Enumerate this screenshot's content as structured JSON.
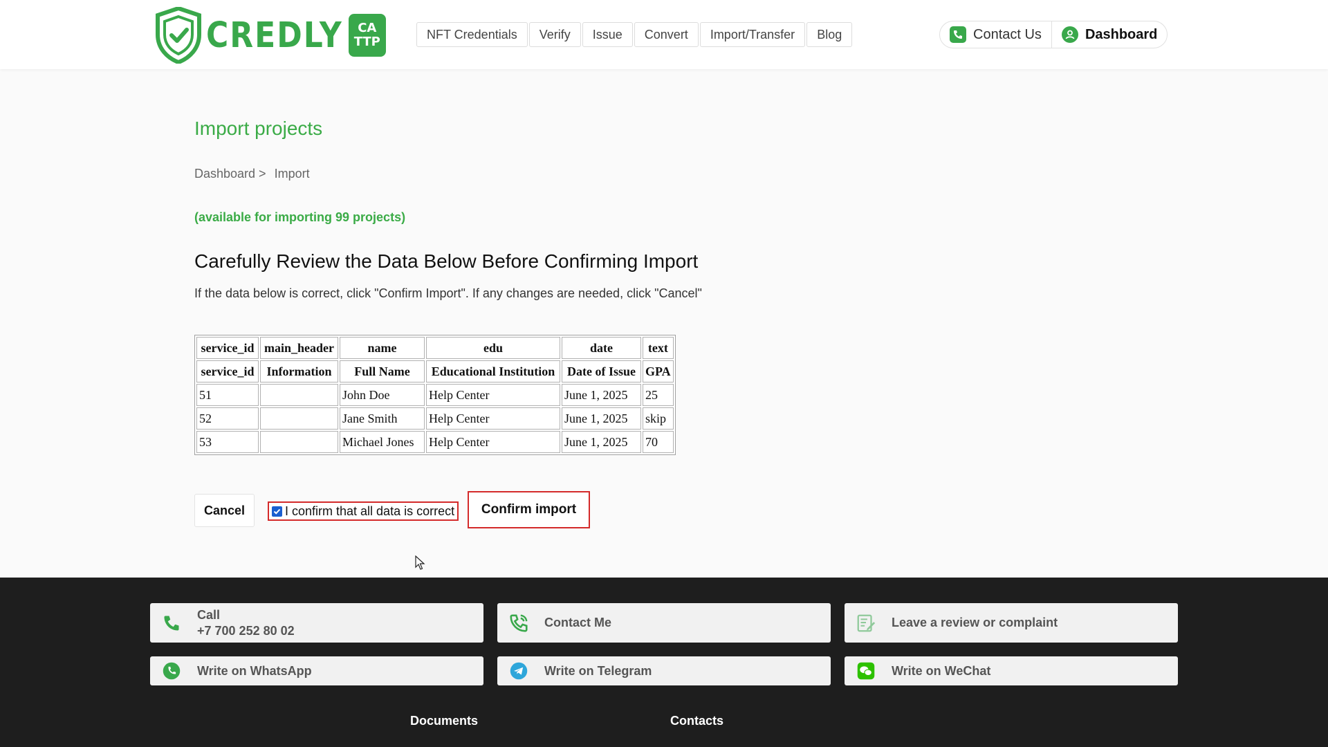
{
  "header": {
    "logo_text": "CREDLY",
    "logo_badge_top": "CA",
    "logo_badge_bottom": "TTP",
    "nav": [
      "NFT Credentials",
      "Verify",
      "Issue",
      "Convert",
      "Import/Transfer",
      "Blog"
    ],
    "contact_label": "Contact Us",
    "dashboard_label": "Dashboard"
  },
  "main": {
    "title": "Import projects",
    "breadcrumb": {
      "parent": "Dashboard >",
      "current": "Import"
    },
    "available": "(available for importing 99 projects)",
    "review_heading": "Carefully Review the Data Below Before Confirming Import",
    "review_sub": "If the data below is correct, click \"Confirm Import\". If any changes are needed, click \"Cancel\"",
    "table": {
      "header_keys": [
        "service_id",
        "main_header",
        "name",
        "edu",
        "date",
        "text"
      ],
      "header_labels": [
        "service_id",
        "Information",
        "Full Name",
        "Educational Institution",
        "Date of Issue",
        "GPA"
      ],
      "rows": [
        [
          "51",
          "",
          "John Doe",
          "Help Center",
          "June 1, 2025",
          "25"
        ],
        [
          "52",
          "",
          "Jane Smith",
          "Help Center",
          "June 1, 2025",
          "skip"
        ],
        [
          "53",
          "",
          "Michael Jones",
          "Help Center",
          "June 1, 2025",
          "70"
        ]
      ]
    },
    "cancel_label": "Cancel",
    "confirm_checkbox_label": "I confirm that all data is correct",
    "confirm_checked": true,
    "confirm_button_label": "Confirm import"
  },
  "footer": {
    "call_label": "Call",
    "call_number": "+7 700 252 80 02",
    "contact_me": "Contact Me",
    "review": "Leave a review or complaint",
    "whatsapp": "Write on WhatsApp",
    "telegram": "Write on Telegram",
    "wechat": "Write on WeChat",
    "documents": "Documents",
    "contacts": "Contacts"
  },
  "colors": {
    "brand_green": "#39a84b",
    "highlight_red": "#d42a2a",
    "footer_bg": "#1e1e1e"
  }
}
